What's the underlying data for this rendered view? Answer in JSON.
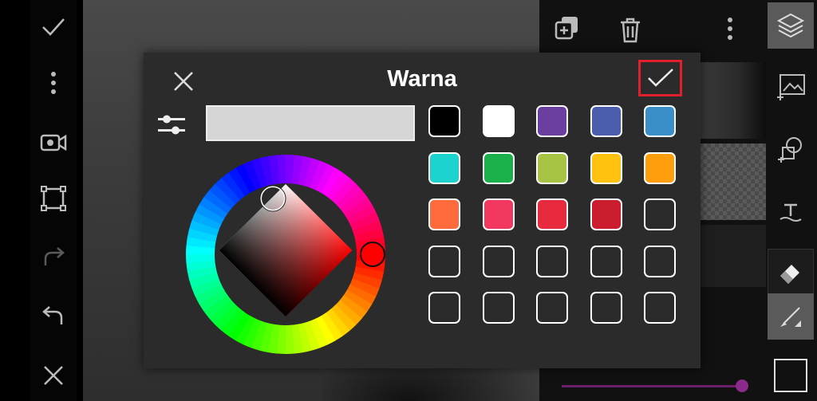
{
  "dialog": {
    "title": "Warna",
    "close_icon": "close-icon",
    "confirm_icon": "checkmark-icon",
    "adjust_icon": "sliders-icon",
    "current_color": "#d6d6d6",
    "hue": "#ff0000"
  },
  "palette": [
    {
      "color": "#000000",
      "empty": false
    },
    {
      "color": "#ffffff",
      "empty": false
    },
    {
      "color": "#6a3fa0",
      "empty": false
    },
    {
      "color": "#4a5ead",
      "empty": false
    },
    {
      "color": "#3b8fc9",
      "empty": false
    },
    {
      "color": "#1dd3cf",
      "empty": false
    },
    {
      "color": "#1ab04a",
      "empty": false
    },
    {
      "color": "#a8c445",
      "empty": false
    },
    {
      "color": "#ffc20e",
      "empty": false
    },
    {
      "color": "#ff9e0c",
      "empty": false
    },
    {
      "color": "#ff6b3d",
      "empty": false
    },
    {
      "color": "#f2385f",
      "empty": false
    },
    {
      "color": "#e82a3e",
      "empty": false
    },
    {
      "color": "#cc1d2e",
      "empty": false
    },
    {
      "color": "",
      "empty": true
    },
    {
      "color": "",
      "empty": true
    },
    {
      "color": "",
      "empty": true
    },
    {
      "color": "",
      "empty": true
    },
    {
      "color": "",
      "empty": true
    },
    {
      "color": "",
      "empty": true
    },
    {
      "color": "",
      "empty": true
    },
    {
      "color": "",
      "empty": true
    },
    {
      "color": "",
      "empty": true
    },
    {
      "color": "",
      "empty": true
    },
    {
      "color": "",
      "empty": true
    }
  ],
  "left_toolbar": [
    "checkmark-icon",
    "more-vertical-icon",
    "video-camera-icon",
    "crop-frame-icon",
    "redo-icon",
    "undo-icon",
    "close-icon"
  ],
  "layers_toolbar": [
    "add-layer-icon",
    "trash-icon",
    "more-vertical-icon"
  ],
  "right_toolbar": [
    "layers-icon",
    "add-image-icon",
    "add-shape-icon",
    "text-icon",
    "eraser-icon",
    "brush-icon",
    "color-square-icon"
  ],
  "colors": {
    "confirm_highlight": "#e0202a",
    "slider": "#8a2a8a"
  }
}
